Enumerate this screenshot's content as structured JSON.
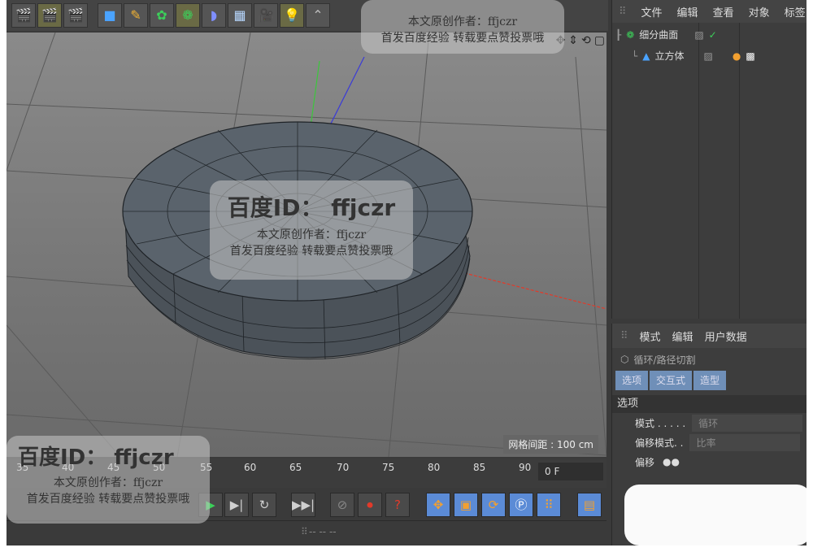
{
  "object_manager": {
    "menu": [
      "文件",
      "编辑",
      "查看",
      "对象",
      "标签"
    ],
    "objects": [
      {
        "name": "细分曲面"
      },
      {
        "name": "立方体"
      }
    ]
  },
  "attributes": {
    "menu": [
      "模式",
      "编辑",
      "用户数据"
    ],
    "tool_name": "循环/路径切割",
    "tabs": [
      "选项",
      "交互式",
      "造型"
    ],
    "section": "选项",
    "fields": [
      {
        "label": "模式 . . . . .",
        "value": "循环"
      },
      {
        "label": "偏移模式. .",
        "value": "比率"
      },
      {
        "label": "偏移",
        "value": ""
      }
    ]
  },
  "viewport": {
    "grid_label": "网格间距 : 100 cm"
  },
  "timeline": {
    "ticks": [
      "35",
      "40",
      "45",
      "50",
      "55",
      "60",
      "65",
      "70",
      "75",
      "80",
      "85",
      "90"
    ],
    "current_frame": "0 F"
  },
  "bottom_bar": {
    "text": "--              --              --"
  },
  "watermark": {
    "id_text": "百度ID： ffjczr",
    "author": "本文原创作者：ffjczr",
    "slogan": "首发百度经验  转载要点赞投票哦",
    "top_author": "本文原创作者：ffjczr",
    "top_slogan": "首发百度经验  转载要点赞投票哦"
  },
  "colors": {
    "x_axis": "#e23a2a",
    "y_axis": "#3cc63c",
    "z_axis": "#3a3ad8",
    "tab_active": "#6f8fb8"
  }
}
